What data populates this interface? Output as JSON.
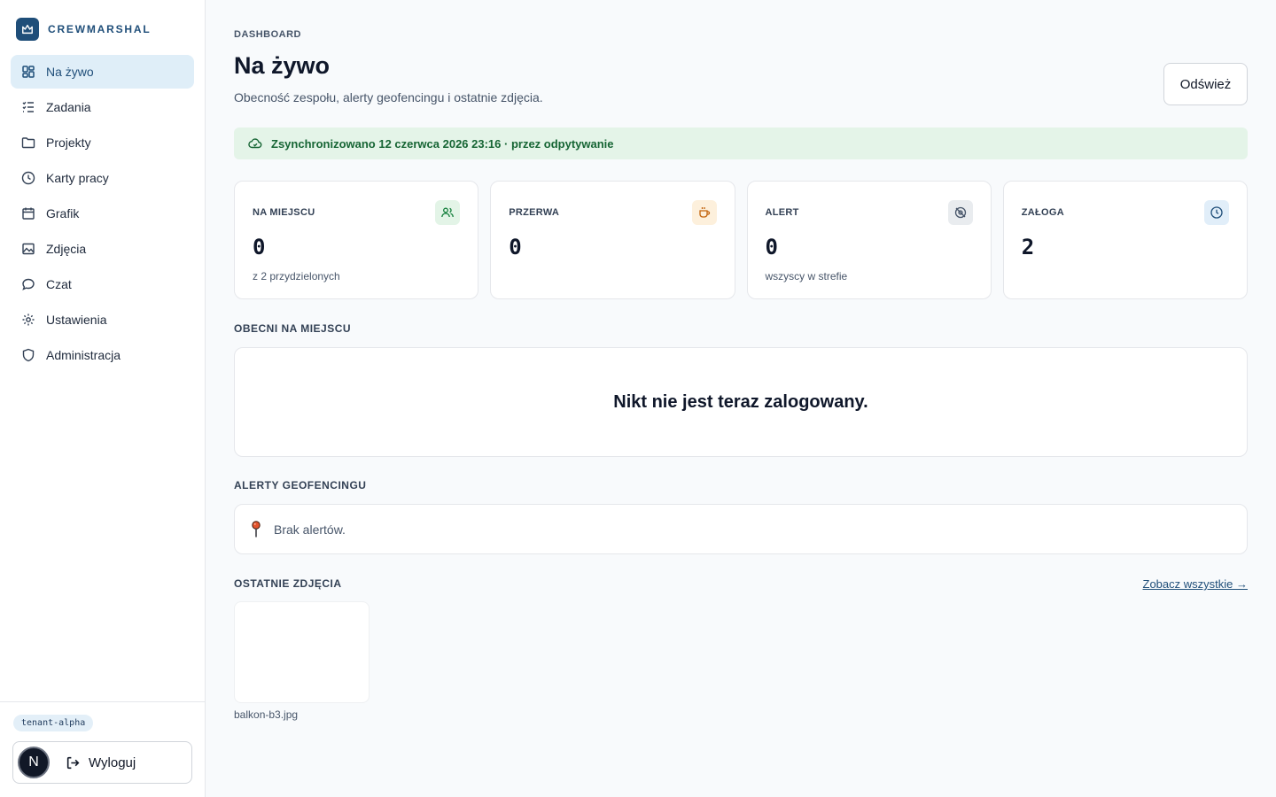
{
  "brand": {
    "name": "CREWMARSHAL"
  },
  "sidebar": {
    "items": [
      {
        "label": "Na żywo",
        "icon": "dashboard-icon",
        "active": true
      },
      {
        "label": "Zadania",
        "icon": "checklist-icon"
      },
      {
        "label": "Projekty",
        "icon": "folder-icon"
      },
      {
        "label": "Karty pracy",
        "icon": "clock-icon"
      },
      {
        "label": "Grafik",
        "icon": "calendar-icon"
      },
      {
        "label": "Zdjęcia",
        "icon": "image-icon"
      },
      {
        "label": "Czat",
        "icon": "chat-icon"
      },
      {
        "label": "Ustawienia",
        "icon": "gear-icon"
      },
      {
        "label": "Administracja",
        "icon": "shield-icon"
      }
    ],
    "tenant": "tenant-alpha",
    "avatar_initial": "N",
    "logout_label": "Wyloguj"
  },
  "header": {
    "eyebrow": "DASHBOARD",
    "title": "Na żywo",
    "subtitle": "Obecność zespołu, alerty geofencingu i ostatnie zdjęcia.",
    "refresh_label": "Odśwież"
  },
  "sync": {
    "text": "Zsynchronizowano 12 czerwca 2026 23:16 · przez odpytywanie"
  },
  "stats": [
    {
      "label": "NA MIEJSCU",
      "value": "0",
      "note": "z 2 przydzielonych",
      "icon": "users-icon",
      "color": "#e3f4e7"
    },
    {
      "label": "PRZERWA",
      "value": "0",
      "note": "",
      "icon": "coffee-icon",
      "color": "#fdf0dc"
    },
    {
      "label": "ALERT",
      "value": "0",
      "note": "wszyscy w strefie",
      "icon": "location-off-icon",
      "color": "#e9ecef"
    },
    {
      "label": "ZAŁOGA",
      "value": "2",
      "note": "",
      "icon": "clock-icon",
      "color": "#e1eef9"
    }
  ],
  "present": {
    "title": "OBECNI NA MIEJSCU",
    "empty": "Nikt nie jest teraz zalogowany."
  },
  "alerts": {
    "title": "ALERTY GEOFENCINGU",
    "empty": "Brak alertów."
  },
  "photos": {
    "title": "OSTATNIE ZDJĘCIA",
    "see_all": "Zobacz wszystkie →",
    "items": [
      {
        "name": "balkon-b3.jpg"
      }
    ]
  }
}
